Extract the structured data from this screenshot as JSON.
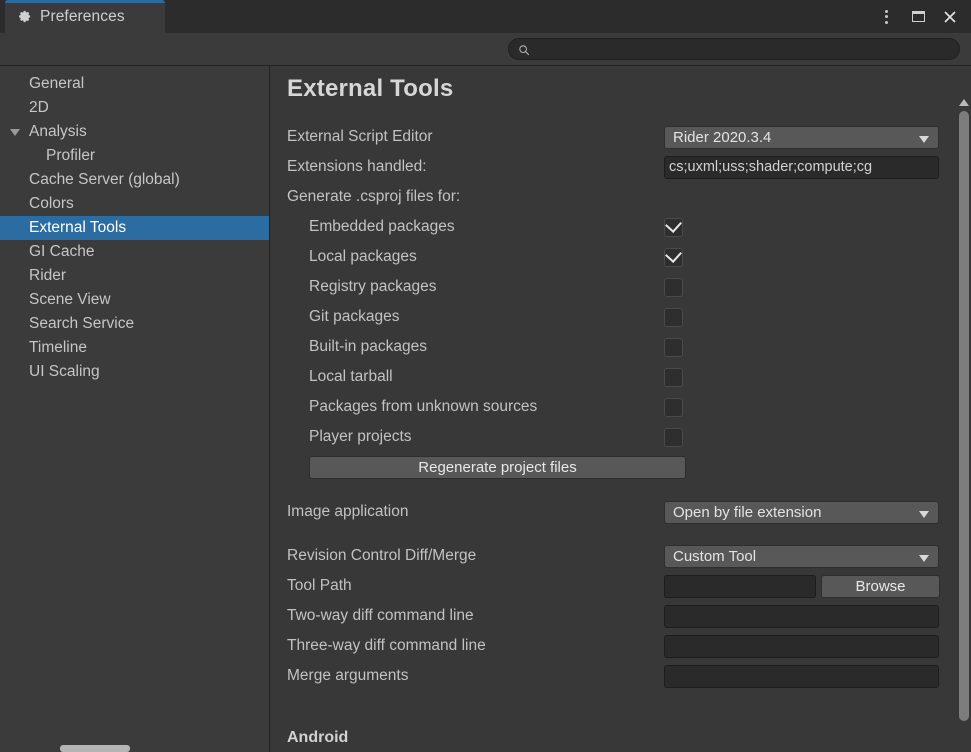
{
  "window": {
    "tab_label": "Preferences",
    "tab_icon": "gear-icon",
    "accent_color": "#2b6ca3",
    "controls": {
      "menu": "more-vertical-icon",
      "maximize": "maximize-icon",
      "close": "close-icon",
      "close_glyph": "✕"
    }
  },
  "search": {
    "value": "",
    "placeholder": "",
    "icon": "search-icon"
  },
  "sidebar": {
    "items": [
      {
        "label": "General",
        "indent": false,
        "expandable": false,
        "selected": false
      },
      {
        "label": "2D",
        "indent": false,
        "expandable": false,
        "selected": false
      },
      {
        "label": "Analysis",
        "indent": false,
        "expandable": true,
        "selected": false
      },
      {
        "label": "Profiler",
        "indent": true,
        "expandable": false,
        "selected": false
      },
      {
        "label": "Cache Server (global)",
        "indent": false,
        "expandable": false,
        "selected": false
      },
      {
        "label": "Colors",
        "indent": false,
        "expandable": false,
        "selected": false
      },
      {
        "label": "External Tools",
        "indent": false,
        "expandable": false,
        "selected": true
      },
      {
        "label": "GI Cache",
        "indent": false,
        "expandable": false,
        "selected": false
      },
      {
        "label": "Rider",
        "indent": false,
        "expandable": false,
        "selected": false
      },
      {
        "label": "Scene View",
        "indent": false,
        "expandable": false,
        "selected": false
      },
      {
        "label": "Search Service",
        "indent": false,
        "expandable": false,
        "selected": false
      },
      {
        "label": "Timeline",
        "indent": false,
        "expandable": false,
        "selected": false
      },
      {
        "label": "UI Scaling",
        "indent": false,
        "expandable": false,
        "selected": false
      }
    ]
  },
  "main": {
    "title": "External Tools",
    "script_editor": {
      "label": "External Script Editor",
      "value": "Rider 2020.3.4"
    },
    "extensions": {
      "label": "Extensions handled:",
      "value": "cs;uxml;uss;shader;compute;cg"
    },
    "csproj": {
      "label": "Generate .csproj files for:",
      "options": [
        {
          "label": "Embedded packages",
          "checked": true
        },
        {
          "label": "Local packages",
          "checked": true
        },
        {
          "label": "Registry packages",
          "checked": false
        },
        {
          "label": "Git packages",
          "checked": false
        },
        {
          "label": "Built-in packages",
          "checked": false
        },
        {
          "label": "Local tarball",
          "checked": false
        },
        {
          "label": "Packages from unknown sources",
          "checked": false
        },
        {
          "label": "Player projects",
          "checked": false
        }
      ],
      "regenerate_label": "Regenerate project files"
    },
    "image_application": {
      "label": "Image application",
      "value": "Open by file extension"
    },
    "revision_control": {
      "label": "Revision Control Diff/Merge",
      "value": "Custom Tool"
    },
    "tool_path": {
      "label": "Tool Path",
      "value": "",
      "browse_label": "Browse"
    },
    "two_way_diff": {
      "label": "Two-way diff command line",
      "value": ""
    },
    "three_way_diff": {
      "label": "Three-way diff command line",
      "value": ""
    },
    "merge_arguments": {
      "label": "Merge arguments",
      "value": ""
    },
    "android_section": {
      "label": "Android"
    }
  }
}
